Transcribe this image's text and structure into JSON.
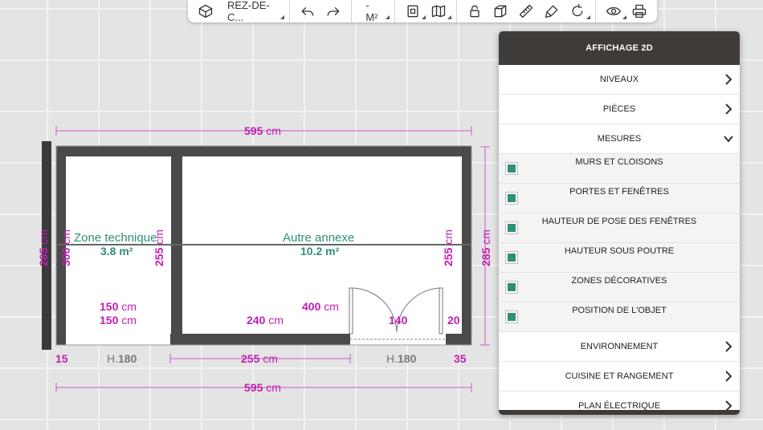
{
  "toolbar": {
    "level_label": "REZ-DE-C...",
    "area_label": "- M²",
    "icons": [
      "cube-outline-icon",
      "undo-icon",
      "redo-icon",
      "room-view-icon",
      "map-icon",
      "lock-icon",
      "3d-box-icon",
      "ruler-icon",
      "paint-icon",
      "rotate-icon",
      "eye-icon",
      "print-icon"
    ]
  },
  "plan": {
    "top_total": "595",
    "unit": "cm",
    "left_outer": "285",
    "left_inner": "300",
    "right_outer": "285",
    "right_inner": "255",
    "middle_inner": "255",
    "room1": {
      "name": "Zone technique",
      "area": "3.8 m²"
    },
    "room2": {
      "name": "Autre annexe",
      "area": "10.2 m²"
    },
    "dim_150_a": "150",
    "dim_150_b": "150",
    "dim_400": "400",
    "dim_240": "240",
    "dim_140": "140",
    "dim_20": "20",
    "dim_15": "15",
    "dim_35": "35",
    "h_left_prefix": "H.",
    "h_left_val": "180",
    "h_right_prefix": "H.",
    "h_right_val": "180",
    "dim_255_bottom": "255",
    "bottom_total": "595"
  },
  "panel": {
    "title": "AFFICHAGE 2D",
    "items": [
      {
        "label": "NIVEAUX"
      },
      {
        "label": "PIÈCES"
      },
      {
        "label": "MESURES"
      }
    ],
    "mesures": [
      {
        "label": "MURS ET CLOISONS",
        "checked": true
      },
      {
        "label": "PORTES ET FENÊTRES",
        "checked": true
      },
      {
        "label": "HAUTEUR DE POSE DES FENÊTRES",
        "checked": true
      },
      {
        "label": "HAUTEUR SOUS POUTRE",
        "checked": true
      },
      {
        "label": "ZONES DÉCORATIVES",
        "checked": true
      },
      {
        "label": "POSITION DE L'OBJET",
        "checked": true
      }
    ],
    "more": [
      {
        "label": "ENVIRONNEMENT"
      },
      {
        "label": "CUISINE ET RANGEMENT"
      },
      {
        "label": "PLAN ÉLECTRIQUE"
      }
    ]
  }
}
